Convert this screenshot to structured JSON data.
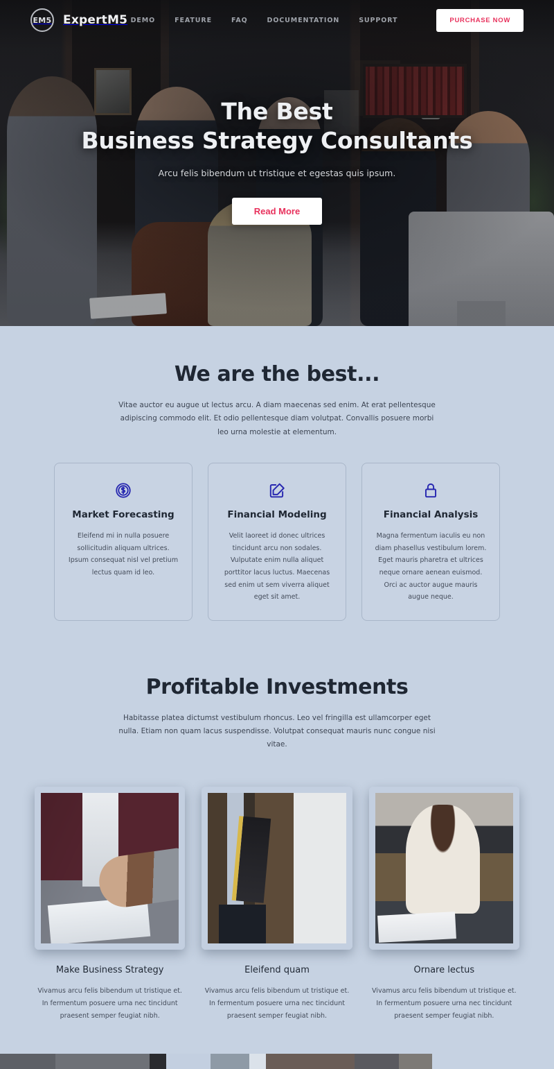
{
  "brand": {
    "mark": "EM5",
    "name": "ExpertM5"
  },
  "nav": {
    "links": [
      {
        "label": "DEMO"
      },
      {
        "label": "FEATURE"
      },
      {
        "label": "FAQ"
      },
      {
        "label": "DOCUMENTATION"
      },
      {
        "label": "SUPPORT"
      }
    ],
    "cta": "PURCHASE NOW"
  },
  "hero": {
    "title_line1": "The Best",
    "title_line2": "Business Strategy Consultants",
    "subtitle": "Arcu felis bibendum ut tristique et egestas quis ipsum.",
    "button": "Read More"
  },
  "best": {
    "title": "We are the best...",
    "description": "Vitae auctor eu augue ut lectus arcu. A diam maecenas sed enim. At erat pellentesque adipiscing commodo elit. Et odio pellentesque diam volutpat. Convallis posuere morbi leo urna molestie at elementum.",
    "cards": [
      {
        "icon": "dollar-circle-icon",
        "title": "Market Forecasting",
        "body": "Eleifend mi in nulla posuere sollicitudin aliquam ultrices. Ipsum consequat nisl vel pretium lectus quam id leo."
      },
      {
        "icon": "edit-square-icon",
        "title": "Financial Modeling",
        "body": "Velit laoreet id donec ultrices tincidunt arcu non sodales. Vulputate enim nulla aliquet porttitor lacus luctus. Maecenas sed enim ut sem viverra aliquet eget sit amet."
      },
      {
        "icon": "lock-icon",
        "title": "Financial Analysis",
        "body": "Magna fermentum iaculis eu non diam phasellus vestibulum lorem. Eget mauris pharetra et ultrices neque ornare aenean euismod. Orci ac auctor augue mauris augue neque."
      }
    ]
  },
  "investments": {
    "title": "Profitable Investments",
    "description": "Habitasse platea dictumst vestibulum rhoncus. Leo vel fringilla est ullamcorper eget nulla. Etiam non quam lacus suspendisse. Volutpat consequat mauris nunc congue nisi vitae.",
    "items": [
      {
        "image": "handshake-photo",
        "title": "Make Business Strategy",
        "body": "Vivamus arcu felis bibendum ut tristique et. In fermentum posuere urna nec tincidunt praesent semper feugiat nibh."
      },
      {
        "image": "businessman-folders-photo",
        "title": "Eleifend quam",
        "body": "Vivamus arcu felis bibendum ut tristique et. In fermentum posuere urna nec tincidunt praesent semper feugiat nibh."
      },
      {
        "image": "woman-at-desk-photo",
        "title": "Ornare lectus",
        "body": "Vivamus arcu felis bibendum ut tristique et. In fermentum posuere urna nec tincidunt praesent semper feugiat nibh."
      }
    ]
  },
  "colors": {
    "accent_pink": "#e8315c",
    "icon_blue": "#2727b0",
    "section_bg": "#c6d2e2",
    "heading": "#1f2733"
  }
}
